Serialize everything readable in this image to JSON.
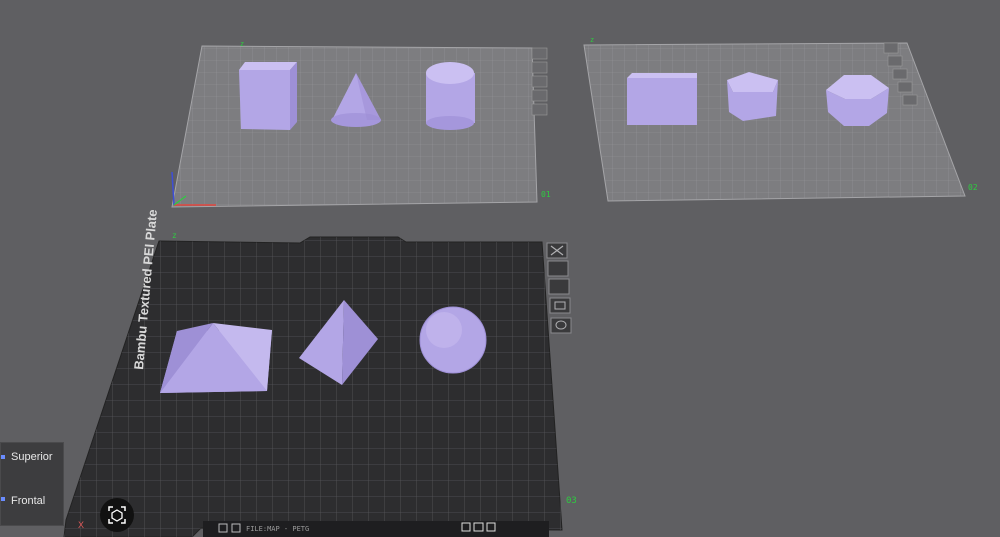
{
  "plates": [
    {
      "id": "plate-1",
      "number": "01"
    },
    {
      "id": "plate-2",
      "number": "02"
    },
    {
      "id": "plate-3",
      "number": "03",
      "brand_text": "Bambu Textured PEI Plate"
    }
  ],
  "view_panel": {
    "items": [
      {
        "label": "Superior"
      },
      {
        "label": "Frontal"
      }
    ]
  },
  "axis": {
    "x_label": "X"
  },
  "bottom_bar": {
    "text": "FILE:MAP - PETG"
  },
  "colors": {
    "background": "#5f5f62",
    "object_fill": "#b3a6e6",
    "active_plate": "#2d2d2f",
    "plate_number": "#2ecc40"
  },
  "icons": [
    "close-icon",
    "auto-orient-icon",
    "arrange-icon",
    "lock-icon",
    "settings-icon",
    "camera-icon"
  ]
}
